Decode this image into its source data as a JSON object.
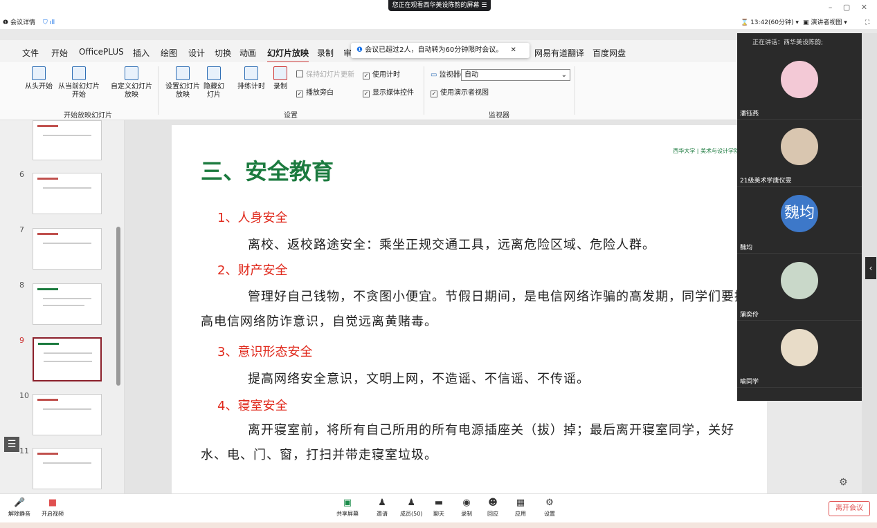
{
  "share_banner": {
    "text": "您正在观看西华美设陈韵的屏幕 ☰"
  },
  "meeting": {
    "details": "会议详情",
    "time": "13:42(60分钟)",
    "presenter_view": "演讲者视图",
    "toast": "会议已超过2人，自动转为60分钟限时会议。"
  },
  "ribbon_tabs": [
    "文件",
    "开始",
    "OfficePLUS",
    "插入",
    "绘图",
    "设计",
    "切换",
    "动画",
    "幻灯片放映",
    "录制",
    "审",
    "网易有道翻译",
    "百度网盘"
  ],
  "ribbon": {
    "from_start": "从头开始",
    "from_current": "从当前幻灯片开始",
    "custom": "自定义幻灯片放映",
    "group_start": "开始放映幻灯片",
    "setup": "设置幻灯片放映",
    "hide": "隐藏幻灯片",
    "rehearse": "排练计时",
    "record": "录制",
    "keep_updated": "保持幻灯片更新",
    "use_timing": "使用计时",
    "play_narration": "播放旁白",
    "show_media": "显示媒体控件",
    "group_setup": "设置",
    "monitor_label": "监视器(M):",
    "monitor_value": "自动",
    "use_presenter": "使用演示者视图",
    "group_monitor": "监视器"
  },
  "thumb_numbers": [
    "6",
    "7",
    "8",
    "9",
    "10",
    "11"
  ],
  "slide": {
    "title": "三、安全教育",
    "logos": "西华大学 | 美术与设计学院",
    "s1": "1、人身安全",
    "p1": "离校、返校路途安全：乘坐正规交通工具，远离危险区域、危险人群。",
    "s2": "2、财产安全",
    "p2": "管理好自己钱物，不贪图小便宜。节假日期间，是电信网络诈骗的高发期，同学们要提高电信网络防诈意识，自觉远离黄赌毒。",
    "s3": "3、意识形态安全",
    "p3": "提高网络安全意识，文明上网，不造谣、不信谣、不传谣。",
    "s4": "4、寝室安全",
    "p4": "离开寝室前，将所有自己所用的所有电源插座关（拔）掉；最后离开寝室同学，关好水、电、门、窗，打扫并带走寝室垃圾。"
  },
  "speaking": "正在讲话：西华美设陈韵;",
  "participants": [
    {
      "name": "潘钰燕"
    },
    {
      "name": "21级美术学唐仪雯"
    },
    {
      "name": "魏均",
      "initials": "魏均"
    },
    {
      "name": "蒲奕伶"
    },
    {
      "name": "喻同学"
    }
  ],
  "bottom": {
    "unmute": "解除静音",
    "video": "开启视频",
    "share": "共享屏幕",
    "invite": "邀请",
    "members": "成员(50)",
    "chat": "聊天",
    "record": "录制",
    "react": "回应",
    "apps": "应用",
    "settings": "设置",
    "leave": "离开会议"
  }
}
